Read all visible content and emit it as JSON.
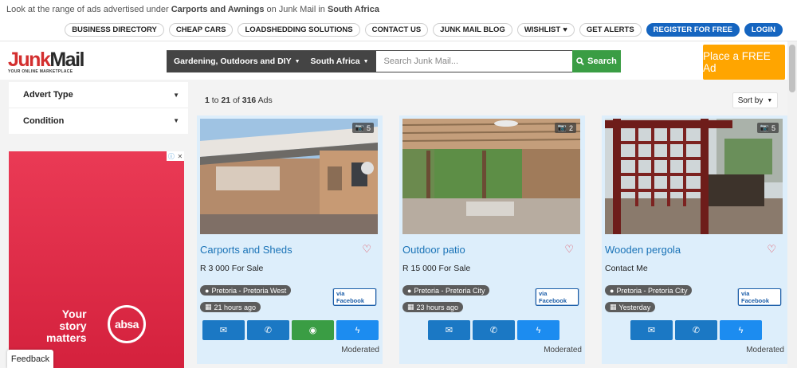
{
  "header": {
    "intro_prefix": "Look at the range of ads advertised under",
    "intro_category": "Carports and Awnings",
    "intro_mid": "on Junk Mail in",
    "intro_region": "South Africa",
    "links": [
      {
        "label": "BUSINESS DIRECTORY"
      },
      {
        "label": "CHEAP CARS"
      },
      {
        "label": "LOADSHEDDING SOLUTIONS"
      },
      {
        "label": "CONTACT US"
      },
      {
        "label": "JUNK MAIL BLOG"
      },
      {
        "label": "WISHLIST",
        "icon": "heart-icon"
      },
      {
        "label": "GET ALERTS"
      },
      {
        "label": "REGISTER FOR FREE"
      },
      {
        "label": "LOGIN"
      }
    ]
  },
  "logo": {
    "junk": "Junk",
    "mail": "Mail",
    "tagline": "YOUR ONLINE MARKETPLACE"
  },
  "search": {
    "category": "Gardening, Outdoors and DIY",
    "region": "South Africa",
    "placeholder": "Search Junk Mail...",
    "button": "Search"
  },
  "place_ad": "Place a FREE Ad",
  "filters": [
    {
      "label": "Advert Type"
    },
    {
      "label": "Condition"
    }
  ],
  "results": {
    "from": "1",
    "to_word": "to",
    "to": "21",
    "of_word": "of",
    "total": "316",
    "suffix": "Ads",
    "sort_label": "Sort by"
  },
  "banner": {
    "line1": "Your",
    "line2": "story",
    "line3": "matters",
    "brand": "absa"
  },
  "feedback": "Feedback",
  "listings": [
    {
      "title": "Carports and Sheds",
      "price": "R 3 000 For Sale",
      "location": "Pretoria - Pretoria West",
      "time": "21 hours ago",
      "photos": "5",
      "facebook": "via Facebook",
      "has_whatsapp": true,
      "status": "Moderated"
    },
    {
      "title": "Outdoor patio",
      "price": "R 15 000 For Sale",
      "location": "Pretoria - Pretoria City",
      "time": "23 hours ago",
      "photos": "2",
      "facebook": "via Facebook",
      "has_whatsapp": false,
      "status": "Moderated"
    },
    {
      "title": "Wooden pergola",
      "price": "Contact Me",
      "location": "Pretoria - Pretoria City",
      "time": "Yesterday",
      "photos": "5",
      "facebook": "via Facebook",
      "has_whatsapp": false,
      "status": "Moderated"
    }
  ],
  "colors": {
    "brand_red": "#d32f2f",
    "search_green": "#3a9d44",
    "place_ad_orange": "#ffa500",
    "card_bg": "#ddeefb",
    "link_blue": "#1a73b7",
    "button_blue": "#1b78c4"
  }
}
